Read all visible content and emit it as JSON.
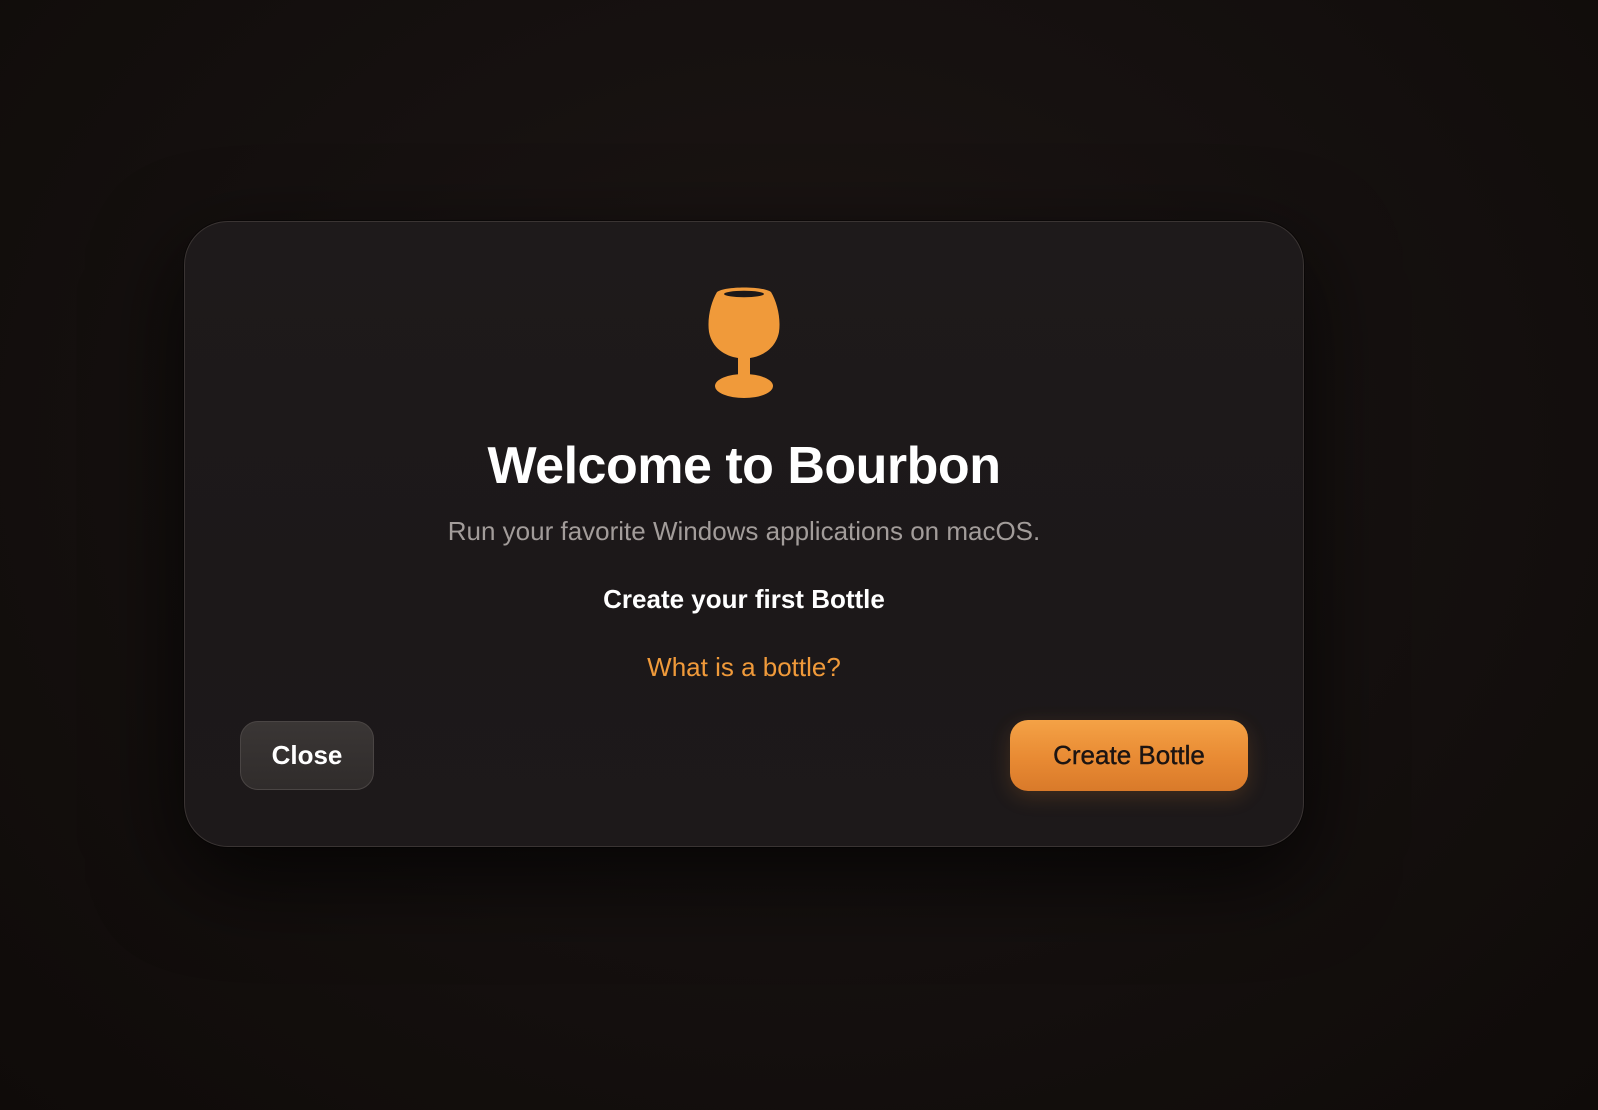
{
  "dialog": {
    "icon": "wine-glass-icon",
    "title": "Welcome to Bourbon",
    "subtitle": "Run your favorite Windows applications on macOS.",
    "section_heading": "Create your first Bottle",
    "help_link": "What is a bottle?",
    "close_label": "Close",
    "create_label": "Create Bottle"
  },
  "colors": {
    "accent": "#f09a3a",
    "background": "#161110",
    "dialog_background": "#1e1a1b",
    "text_primary": "#ffffff",
    "text_secondary": "#a29c9a"
  }
}
